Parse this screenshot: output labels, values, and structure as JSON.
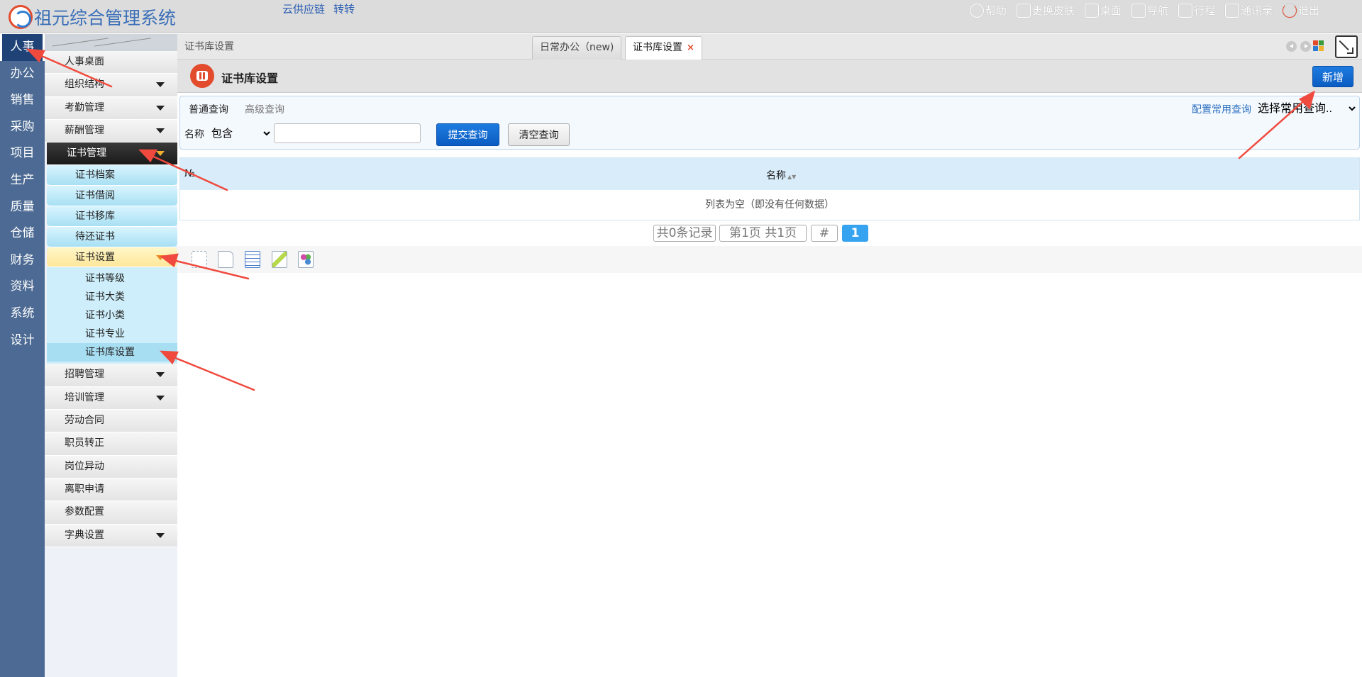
{
  "app": {
    "name": "祖元综合管理系统",
    "top_links": [
      "云供应链",
      "转转"
    ]
  },
  "top_right": [
    {
      "label": "帮助",
      "icon": "help-icon"
    },
    {
      "label": "更换皮肤",
      "icon": "shirt-icon"
    },
    {
      "label": "桌面",
      "icon": "home-icon"
    },
    {
      "label": "导航",
      "icon": "grid-nav-icon"
    },
    {
      "label": "行程",
      "icon": "calendar-icon"
    },
    {
      "label": "通讯录",
      "icon": "contacts-icon"
    },
    {
      "label": "退出",
      "icon": "power-icon"
    }
  ],
  "modules": [
    "人事",
    "办公",
    "销售",
    "采购",
    "项目",
    "生产",
    "质量",
    "仓储",
    "财务",
    "资料",
    "系统",
    "设计"
  ],
  "active_module": "人事",
  "subnav": {
    "items_before": [
      "人事桌面",
      "组织结构",
      "考勤管理",
      "薪酬管理"
    ],
    "open_group": "证书管理",
    "cert_children": [
      "证书档案",
      "证书借阅",
      "证书移库",
      "待还证书"
    ],
    "cert_settings": "证书设置",
    "cert_settings_children": [
      "证书等级",
      "证书大类",
      "证书小类",
      "证书专业",
      "证书库设置"
    ],
    "active_item": "证书库设置",
    "items_after": [
      "招聘管理",
      "培训管理",
      "劳动合同",
      "职员转正",
      "岗位异动",
      "离职申请",
      "参数配置",
      "字典设置"
    ]
  },
  "tabbar": {
    "breadcrumb": "证书库设置",
    "tabs": [
      {
        "label": "日常办公（new)",
        "active": false
      },
      {
        "label": "证书库设置",
        "active": true,
        "close": "×"
      }
    ]
  },
  "page": {
    "title": "证书库设置",
    "new_button": "新增"
  },
  "query": {
    "tab_normal": "普通查询",
    "tab_advanced": "高级查询",
    "config_link": "配置常用查询",
    "common_select": "选择常用查询..",
    "field_label": "名称",
    "operator": "包含",
    "value": "",
    "submit": "提交查询",
    "clear": "清空查询"
  },
  "table": {
    "col_no": "№",
    "col_name": "名称",
    "empty": "列表为空（即没有任何数据）"
  },
  "pager": {
    "total": "共0条记录",
    "page_info": "第1页 共1页",
    "hash": "#",
    "current": "1"
  },
  "colors": {
    "brand_blue": "#0b5cc2",
    "module_nav": "#4c6a93",
    "active_module": "#1f4377",
    "accent_red": "#e34b2d",
    "pager_current": "#35a3ef"
  }
}
